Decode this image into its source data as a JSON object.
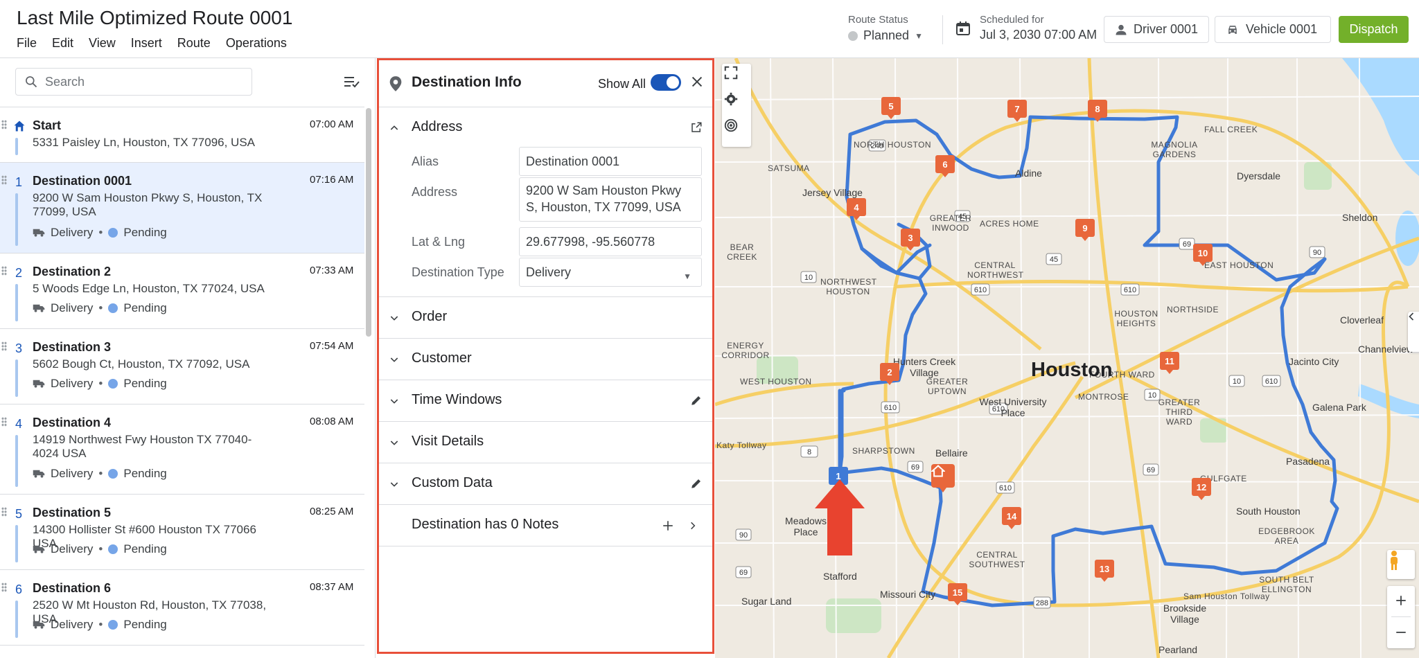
{
  "header": {
    "title": "Last Mile Optimized Route 0001",
    "menu": [
      "File",
      "Edit",
      "View",
      "Insert",
      "Route",
      "Operations"
    ],
    "route_status_label": "Route Status",
    "route_status_value": "Planned",
    "scheduled_label": "Scheduled for",
    "scheduled_value": "Jul 3, 2030 07:00 AM",
    "driver": "Driver 0001",
    "vehicle": "Vehicle 0001",
    "dispatch": "Dispatch"
  },
  "search": {
    "placeholder": "Search"
  },
  "stops": [
    {
      "num": "",
      "name": "Start",
      "time": "07:00 AM",
      "address": "5331 Paisley Ln, Houston, TX 77096, USA"
    },
    {
      "num": "1",
      "name": "Destination 0001",
      "time": "07:16 AM",
      "address": "9200 W Sam Houston Pkwy S, Houston, TX 77099, USA",
      "type": "Delivery",
      "status": "Pending"
    },
    {
      "num": "2",
      "name": "Destination 2",
      "time": "07:33 AM",
      "address": "5 Woods Edge Ln, Houston, TX 77024, USA",
      "type": "Delivery",
      "status": "Pending"
    },
    {
      "num": "3",
      "name": "Destination 3",
      "time": "07:54 AM",
      "address": "5602 Bough Ct, Houston, TX 77092, USA",
      "type": "Delivery",
      "status": "Pending"
    },
    {
      "num": "4",
      "name": "Destination 4",
      "time": "08:08 AM",
      "address": "14919 Northwest Fwy Houston TX 77040-4024 USA",
      "type": "Delivery",
      "status": "Pending"
    },
    {
      "num": "5",
      "name": "Destination 5",
      "time": "08:25 AM",
      "address": "14300 Hollister St #600 Houston TX 77066 USA",
      "type": "Delivery",
      "status": "Pending"
    },
    {
      "num": "6",
      "name": "Destination 6",
      "time": "08:37 AM",
      "address": "2520 W Mt Houston Rd, Houston, TX 77038, USA",
      "type": "Delivery",
      "status": "Pending"
    }
  ],
  "dest_panel": {
    "title": "Destination Info",
    "show_all": "Show All",
    "address_section": "Address",
    "alias_label": "Alias",
    "alias_value": "Destination 0001",
    "address_label": "Address",
    "address_value": "9200 W Sam Houston Pkwy S, Houston, TX 77099, USA",
    "latlng_label": "Lat & Lng",
    "latlng_value": "29.677998, -95.560778",
    "type_label": "Destination Type",
    "type_value": "Delivery",
    "sections": [
      "Order",
      "Customer",
      "Time Windows",
      "Visit Details",
      "Custom Data"
    ],
    "notes": "Destination has 0 Notes"
  },
  "map": {
    "city_label": "Houston",
    "labels": [
      {
        "t": "NORTH HOUSTON"
      },
      {
        "t": "SATSUMA"
      },
      {
        "t": "Jersey Village"
      },
      {
        "t": "Aldine"
      },
      {
        "t": "MAGNOLIA GARDENS"
      },
      {
        "t": "FALL CREEK"
      },
      {
        "t": "Dyersdale"
      },
      {
        "t": "Sheldon"
      },
      {
        "t": "ACRES HOME"
      },
      {
        "t": "GREATER INWOOD"
      },
      {
        "t": "EAST HOUSTON"
      },
      {
        "t": "CENTRAL NORTHWEST"
      },
      {
        "t": "NORTHWEST HOUSTON"
      },
      {
        "t": "BEAR CREEK"
      },
      {
        "t": "HOUSTON HEIGHTS"
      },
      {
        "t": "NORTHSIDE"
      },
      {
        "t": "Cloverleaf"
      },
      {
        "t": "Channelview"
      },
      {
        "t": "ENERGY CORRIDOR"
      },
      {
        "t": "WEST HOUSTON"
      },
      {
        "t": "Hunters Creek Village"
      },
      {
        "t": "GREATER UPTOWN"
      },
      {
        "t": "Jacinto City"
      },
      {
        "t": "Galena Park"
      },
      {
        "t": "MONTROSE"
      },
      {
        "t": "GREATER THIRD WARD"
      },
      {
        "t": "West University Place"
      },
      {
        "t": "SHARPSTOWN"
      },
      {
        "t": "Bellaire"
      },
      {
        "t": "Pasadena"
      },
      {
        "t": "South Houston"
      },
      {
        "t": "EDGEBROOK AREA"
      },
      {
        "t": "CENTRAL SOUTHWEST"
      },
      {
        "t": "SOUTH BELT ELLINGTON"
      },
      {
        "t": "Meadows Place"
      },
      {
        "t": "Stafford"
      },
      {
        "t": "Missouri City"
      },
      {
        "t": "Sugar Land"
      },
      {
        "t": "Brookside Village"
      },
      {
        "t": "Pearland"
      },
      {
        "t": "FOURTH WARD"
      },
      {
        "t": "GULFGATE"
      },
      {
        "t": "Sam Houston Tollway"
      },
      {
        "t": "Katy Tollway"
      }
    ],
    "markers": [
      "1",
      "2",
      "3",
      "4",
      "5",
      "6",
      "7",
      "8",
      "9",
      "10",
      "11",
      "12",
      "13",
      "14",
      "15"
    ]
  },
  "colors": {
    "accent": "#1a56b8",
    "dispatch": "#73b02a",
    "marker": "#e8673b",
    "route": "#3f7ad6",
    "highlight_border": "#e8503a"
  }
}
